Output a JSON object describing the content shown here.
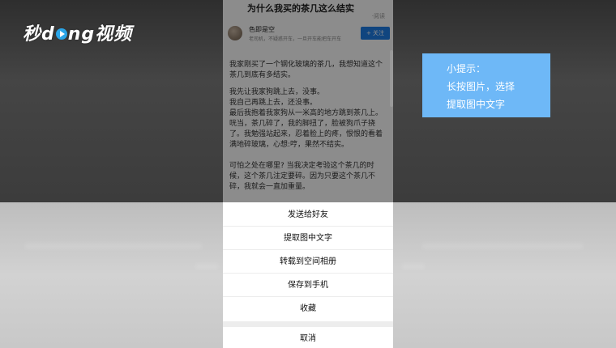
{
  "watermark": {
    "brand_pre": "秒d",
    "brand_post": "ng视频"
  },
  "article": {
    "title": "为什么我买的茶几这么结实",
    "meta": "·阅读",
    "author_name": "色即是空",
    "author_sub": "老司机，不疑惑开车，一旦开车能把车开车",
    "follow_label": "+ 关注",
    "paragraphs": [
      "我家刚买了一个钢化玻璃的茶几，我想知道这个茶几到底有多结实。",
      "我先让我家狗跳上去，没事。\n我自己再跳上去，还没事。\n最后我抱着我家狗从一米高的地方跳到茶几上。咣当，茶几碎了，我的脚扭了，脸被狗爪子挠了。我勉强站起来，忍着脸上的疼，恨恨的看着满地碎玻璃，心想:哼，果然不结实。",
      "可怕之处在哪里? 当我决定考验这个茶几的时候，这个茶几注定要碎。因为只要这个茶几不碎，我就会一直加重量。"
    ]
  },
  "action_sheet": {
    "items": [
      "发送给好友",
      "提取图中文字",
      "转载到空间相册",
      "保存到手机",
      "收藏"
    ],
    "cancel_label": "取消"
  },
  "tip": {
    "title": "小提示：",
    "line1": "长按图片，选择",
    "line2": "提取图中文字"
  },
  "colors": {
    "accent": "#1e7ee8",
    "tip_bg": "#6eb8f7"
  }
}
